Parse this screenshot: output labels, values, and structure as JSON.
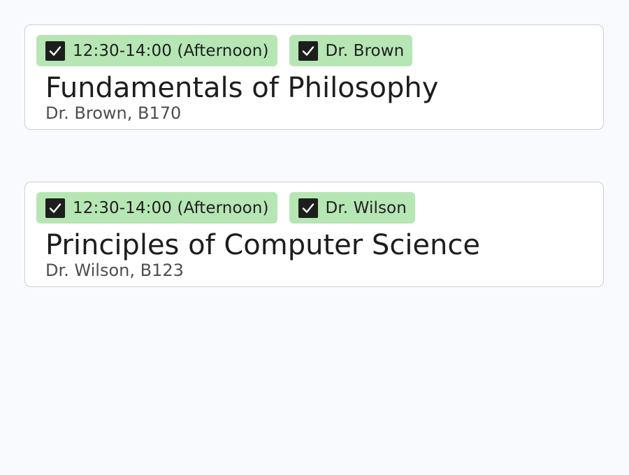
{
  "colors": {
    "background": "#f9fafd",
    "card": "#ffffff",
    "card_border": "#cfcfcf",
    "tag_selected": "#b6e6b4",
    "checkbox": "#1c1f1c",
    "check_mark": "#ffffff"
  },
  "courses": [
    {
      "title": "Fundamentals of Philosophy",
      "subtitle": "Dr. Brown, B170",
      "tags": [
        {
          "label": "12:30-14:00 (Afternoon)",
          "checked": true,
          "icon": "checkbox-checked-icon"
        },
        {
          "label": "Dr. Brown",
          "checked": true,
          "icon": "checkbox-checked-icon"
        }
      ]
    },
    {
      "title": "Principles of Computer Science",
      "subtitle": "Dr. Wilson, B123",
      "tags": [
        {
          "label": "12:30-14:00 (Afternoon)",
          "checked": true,
          "icon": "checkbox-checked-icon"
        },
        {
          "label": "Dr. Wilson",
          "checked": true,
          "icon": "checkbox-checked-icon"
        }
      ]
    }
  ]
}
